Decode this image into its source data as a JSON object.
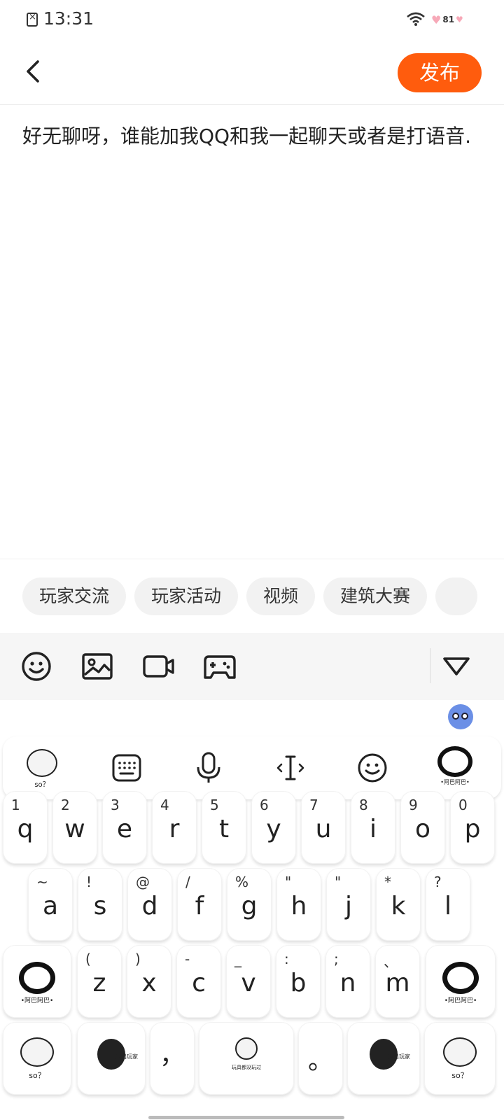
{
  "status_bar": {
    "time": "13:31",
    "battery": "81",
    "icons": [
      "no-sim-icon",
      "wifi-icon",
      "battery-heart-icon"
    ]
  },
  "header": {
    "publish_label": "发布",
    "back_icon": "chevron-left-icon",
    "accent_color": "#ff5c0d"
  },
  "post": {
    "text": "好无聊呀，谁能加我QQ和我一起聊天或者是打语音."
  },
  "tags": [
    "玩家交流",
    "玩家活动",
    "视频",
    "建筑大赛",
    ""
  ],
  "toolbar": {
    "icons": [
      "emoji-icon",
      "image-icon",
      "video-icon",
      "gamepad-icon",
      "collapse-triangle-icon"
    ]
  },
  "keyboard": {
    "topbar_icons": [
      "panda-sticker",
      "keyboard-icon",
      "microphone-icon",
      "cursor-icon",
      "emoji-icon",
      "panda-sticker"
    ],
    "sticker_captions": {
      "so": "so？",
      "aba": "•阿巴阿巴•",
      "quit": "退出玩家",
      "chat": "玩具都没玩过"
    },
    "row1": [
      {
        "sub": "1",
        "main": "q"
      },
      {
        "sub": "2",
        "main": "w"
      },
      {
        "sub": "3",
        "main": "e"
      },
      {
        "sub": "4",
        "main": "r"
      },
      {
        "sub": "5",
        "main": "t"
      },
      {
        "sub": "6",
        "main": "y"
      },
      {
        "sub": "7",
        "main": "u"
      },
      {
        "sub": "8",
        "main": "i"
      },
      {
        "sub": "9",
        "main": "o"
      },
      {
        "sub": "0",
        "main": "p"
      }
    ],
    "row2": [
      {
        "sub": "~",
        "main": "a"
      },
      {
        "sub": "!",
        "main": "s"
      },
      {
        "sub": "@",
        "main": "d"
      },
      {
        "sub": "/",
        "main": "f"
      },
      {
        "sub": "%",
        "main": "g"
      },
      {
        "sub": "\"",
        "main": "h"
      },
      {
        "sub": "\"",
        "main": "j"
      },
      {
        "sub": "*",
        "main": "k"
      },
      {
        "sub": "?",
        "main": "l"
      }
    ],
    "row3": [
      {
        "sub": "(",
        "main": "z"
      },
      {
        "sub": ")",
        "main": "x"
      },
      {
        "sub": "-",
        "main": "c"
      },
      {
        "sub": "_",
        "main": "v"
      },
      {
        "sub": ":",
        "main": "b"
      },
      {
        "sub": ";",
        "main": "n"
      },
      {
        "sub": "、",
        "main": "m"
      }
    ],
    "row4": {
      "comma": "，",
      "period": "。"
    }
  }
}
